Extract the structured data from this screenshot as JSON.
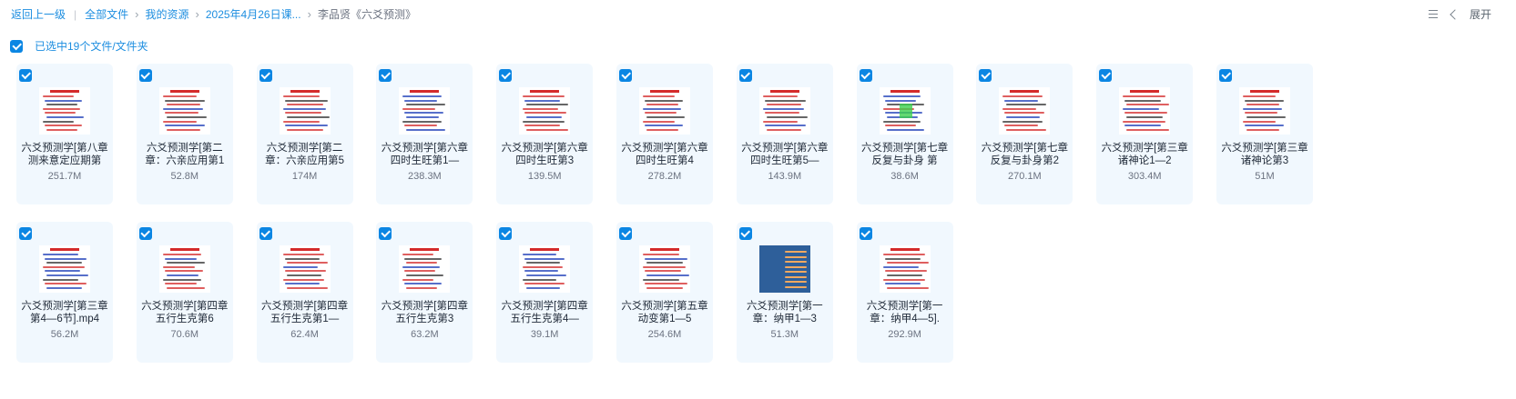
{
  "breadcrumb": {
    "back": "返回上一级",
    "items": [
      "全部文件",
      "我的资源",
      "2025年4月26日课..."
    ],
    "current": "李品贤《六爻预测》"
  },
  "toolbar": {
    "expand_label": "展开"
  },
  "selection": {
    "text": "已选中19个文件/文件夹"
  },
  "files": [
    {
      "name": "六爻预测学[第八章 测来意定应期第",
      "size": "251.7M"
    },
    {
      "name": "六爻预测学[第二章：六亲应用第1",
      "size": "52.8M"
    },
    {
      "name": "六爻预测学[第二章：六亲应用第5",
      "size": "174M"
    },
    {
      "name": "六爻预测学[第六章 四时生旺第1—",
      "size": "238.3M"
    },
    {
      "name": "六爻预测学[第六章 四时生旺第3",
      "size": "139.5M"
    },
    {
      "name": "六爻预测学[第六章 四时生旺第4",
      "size": "278.2M"
    },
    {
      "name": "六爻预测学[第六章 四时生旺第5—",
      "size": "143.9M"
    },
    {
      "name": "六爻预测学[第七章 反复与卦身 第",
      "size": "38.6M"
    },
    {
      "name": "六爻预测学[第七章 反复与卦身第2",
      "size": "270.1M"
    },
    {
      "name": "六爻预测学[第三章 诸神论1—2",
      "size": "303.4M"
    },
    {
      "name": "六爻预测学[第三章 诸神论第3",
      "size": "51M"
    },
    {
      "name": "六爻预测学[第三章第4—6节].mp4",
      "size": "56.2M"
    },
    {
      "name": "六爻预测学[第四章 五行生克第6",
      "size": "70.6M"
    },
    {
      "name": "六爻预测学[第四章 五行生克第1—",
      "size": "62.4M"
    },
    {
      "name": "六爻预测学[第四章 五行生克第3",
      "size": "63.2M"
    },
    {
      "name": "六爻预测学[第四章 五行生克第4—",
      "size": "39.1M"
    },
    {
      "name": "六爻预测学[第五章 动变第1—5",
      "size": "254.6M"
    },
    {
      "name": "六爻预测学[第一章：纳甲1—3",
      "size": "51.3M"
    },
    {
      "name": "六爻预测学[第一章：纳甲4—5].",
      "size": "292.9M"
    }
  ],
  "colors": {
    "accent": "#0b86e3",
    "link": "#1d8ee0",
    "card_bg": "#f1f8fe"
  },
  "icons": {
    "list_view": "list-view-icon",
    "collapse": "chevron-left-icon",
    "check": "checkbox-checked-icon"
  }
}
